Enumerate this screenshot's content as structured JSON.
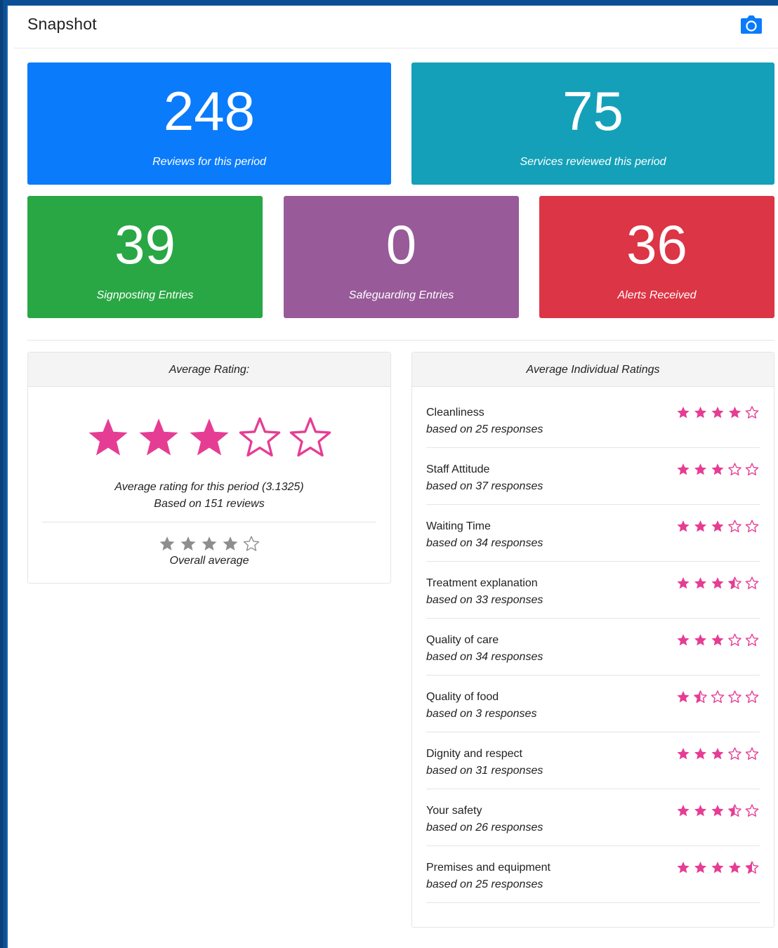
{
  "header": {
    "title": "Snapshot"
  },
  "stats": [
    {
      "value": "248",
      "label": "Reviews for this period",
      "color": "#0a7bfb"
    },
    {
      "value": "75",
      "label": "Services reviewed this period",
      "color": "#14a0b9"
    },
    {
      "value": "39",
      "label": "Signposting Entries",
      "color": "#29a745"
    },
    {
      "value": "0",
      "label": "Safeguarding Entries",
      "color": "#985a98"
    },
    {
      "value": "36",
      "label": "Alerts Received",
      "color": "#dc3545"
    }
  ],
  "average_rating": {
    "title": "Average Rating:",
    "stars": 3,
    "summary": "Average rating for this period (3.1325)",
    "based_on": "Based on 151 reviews",
    "overall_stars": 4,
    "overall_label": "Overall average"
  },
  "individual": {
    "title": "Average Individual Ratings",
    "items": [
      {
        "name": "Cleanliness",
        "responses": "based on 25 responses",
        "stars": 4
      },
      {
        "name": "Staff Attitude",
        "responses": "based on 37 responses",
        "stars": 3
      },
      {
        "name": "Waiting Time",
        "responses": "based on 34 responses",
        "stars": 3
      },
      {
        "name": "Treatment explanation",
        "responses": "based on 33 responses",
        "stars": 3.5
      },
      {
        "name": "Quality of care",
        "responses": "based on 34 responses",
        "stars": 3
      },
      {
        "name": "Quality of food",
        "responses": "based on 3 responses",
        "stars": 1.5
      },
      {
        "name": "Dignity and respect",
        "responses": "based on 31 responses",
        "stars": 3
      },
      {
        "name": "Your safety",
        "responses": "based on 26 responses",
        "stars": 3.5
      },
      {
        "name": "Premises and equipment",
        "responses": "based on 25 responses",
        "stars": 4.5
      }
    ]
  },
  "colors": {
    "star": "#e63d94",
    "star_grey": "#8e8e8e",
    "camera": "#0a7bfb"
  },
  "icons": {
    "camera": "camera-icon",
    "star": "star-icon"
  }
}
